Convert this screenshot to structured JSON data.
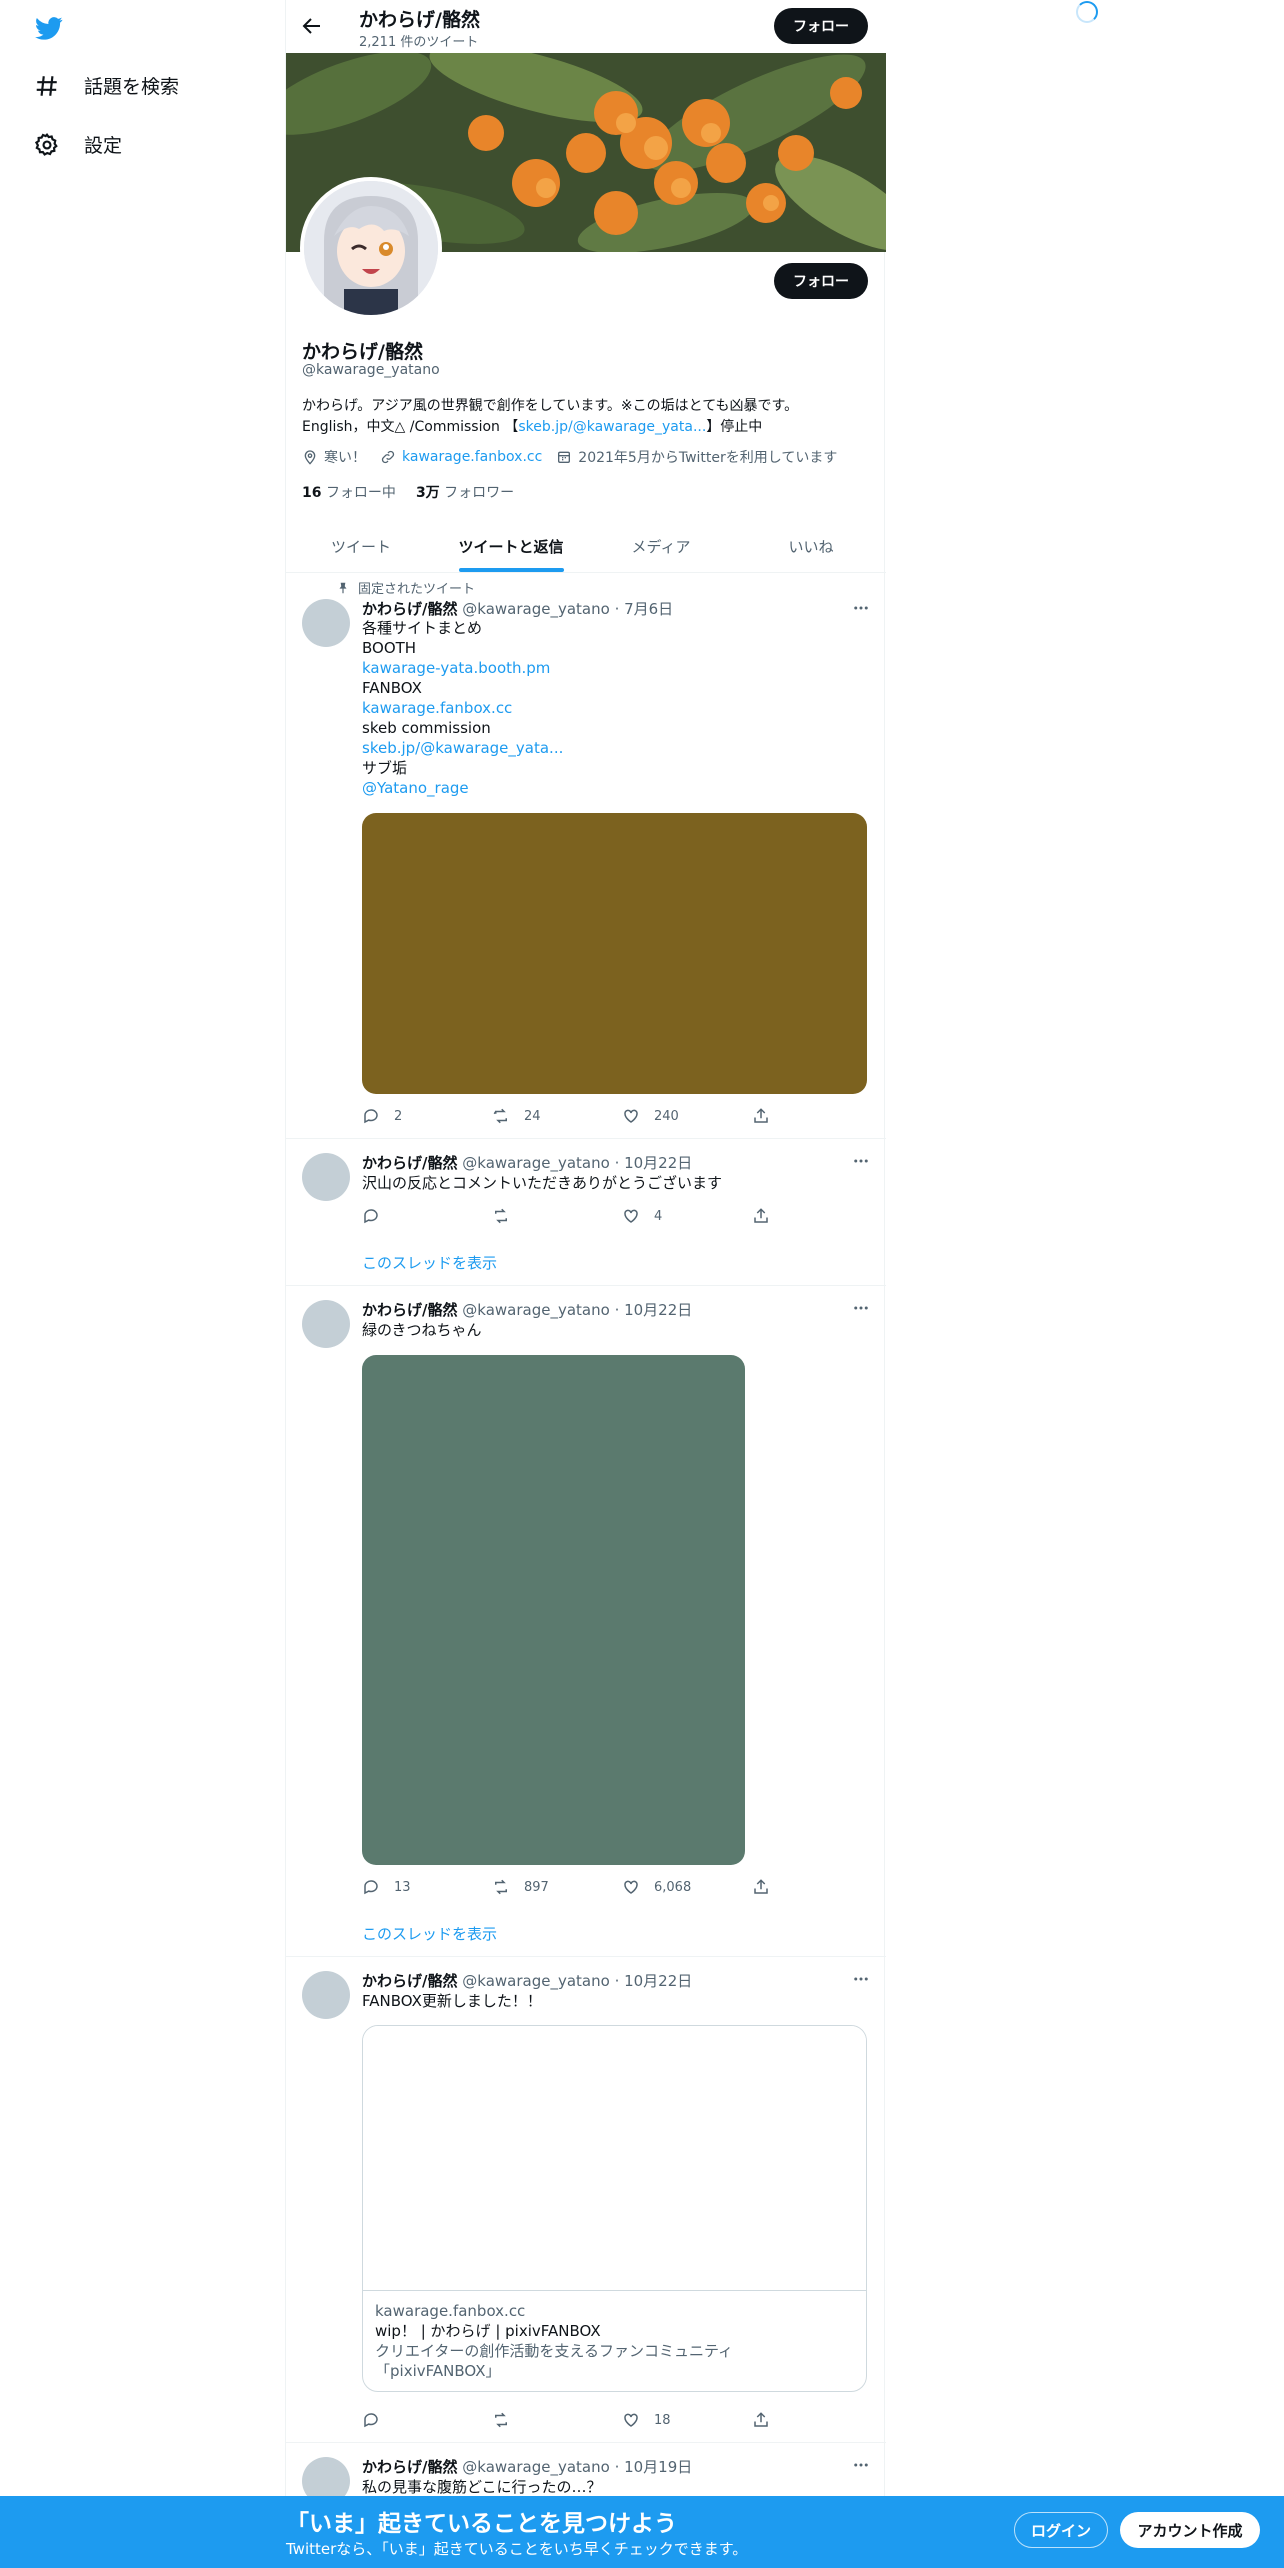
{
  "sidebar": {
    "items": [
      {
        "label": "話題を検索",
        "icon": "hashtag-icon"
      },
      {
        "label": "設定",
        "icon": "gear-icon"
      }
    ]
  },
  "header": {
    "name": "かわらげ/骼然",
    "tweet_count": "2,211 件のツイート",
    "follow_label": "フォロー"
  },
  "profile": {
    "name": "かわらげ/骼然",
    "handle": "@kawarage_yatano",
    "follow_label": "フォロー",
    "bio_line1": "かわらげ。アジア風の世界観で創作をしています。※この垢はとても凶暴です。",
    "bio_line2_prefix": "English，中文△ /Commission 【",
    "bio_line2_link": "skeb.jp/@kawarage_yata...",
    "bio_line2_suffix": "】停止中",
    "location": "寒い！",
    "website": "kawarage.fanbox.cc",
    "joined": "2021年5月からTwitterを利用しています",
    "following_count": "16",
    "following_label": "フォロー中",
    "followers_count": "3万",
    "followers_label": "フォロワー"
  },
  "tabs": [
    "ツイート",
    "ツイートと返信",
    "メディア",
    "いいね"
  ],
  "active_tab": "ツイートと返信",
  "pinned_label": "固定されたツイート",
  "thread_link_label": "このスレッドを表示",
  "tweets": [
    {
      "name": "かわらげ/骼然",
      "handle": "@kawarage_yatano",
      "date": "· 7月6日",
      "lines": [
        "各種サイトまとめ",
        "BOOTH",
        "kawarage-yata.booth.pm",
        "FANBOX",
        "kawarage.fanbox.cc",
        "skeb commission",
        "skeb.jp/@kawarage_yata...",
        "サブ垢",
        "@Yatano_rage"
      ],
      "media_color": "#7c621f",
      "replies": "2",
      "retweets": "24",
      "likes": "240"
    },
    {
      "name": "かわらげ/骼然",
      "handle": "@kawarage_yatano",
      "date": "· 10月22日",
      "lines": [
        "沢山の反応とコメントいただきありがとうございます"
      ],
      "replies": "",
      "retweets": "",
      "likes": "4"
    },
    {
      "name": "かわらげ/骼然",
      "handle": "@kawarage_yatano",
      "date": "· 10月22日",
      "lines": [
        "緑のきつねちゃん"
      ],
      "media_color": "#5b7a6e",
      "replies": "13",
      "retweets": "897",
      "likes": "6,068"
    },
    {
      "name": "かわらげ/骼然",
      "handle": "@kawarage_yatano",
      "date": "· 10月22日",
      "lines": [
        "FANBOX更新しました！！"
      ],
      "card": {
        "domain": "kawarage.fanbox.cc",
        "title": "wip！ | かわらげ | pixivFANBOX",
        "desc1": "クリエイターの創作活動を支えるファンコミュニティ",
        "desc2": "「pixivFANBOX」"
      },
      "replies": "",
      "retweets": "",
      "likes": "18"
    },
    {
      "name": "かわらげ/骼然",
      "handle": "@kawarage_yatano",
      "date": "· 10月19日",
      "lines": [
        "私の見事な腹筋どこに行ったの…？"
      ]
    }
  ],
  "bottom_bar": {
    "title": "「いま」起きていることを見つけよう",
    "subtitle": "Twitterなら、「いま」起きていることをいち早くチェックできます。",
    "login": "ログイン",
    "signup": "アカウント作成"
  },
  "colors": {
    "accent": "#1d9bf0",
    "text": "#0f1419",
    "secondary": "#536471"
  }
}
